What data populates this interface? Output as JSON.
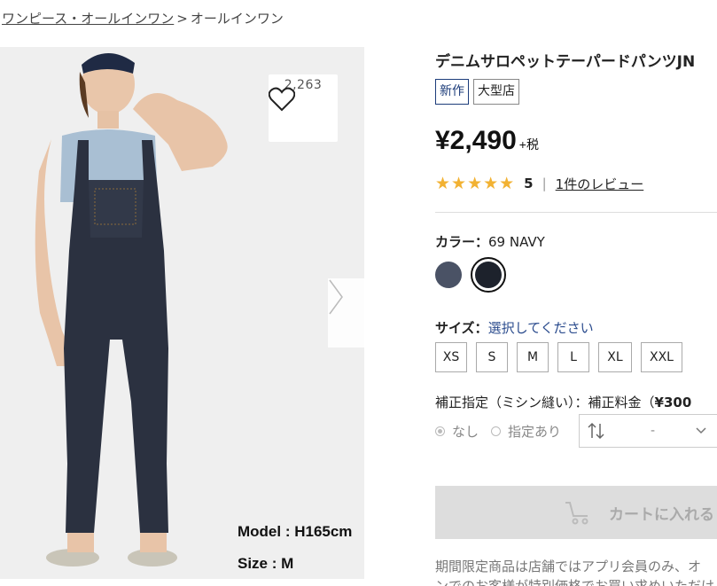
{
  "breadcrumb": {
    "parent": "ワンピース・オールインワン",
    "separator": ">",
    "current": "オールインワン"
  },
  "gallery": {
    "favorite_count": "2,263",
    "caption_model": "Model : H165cm",
    "caption_size": "Size : M"
  },
  "product": {
    "title": "デニムサロペットテーパードパンツJN",
    "badges": [
      "新作",
      "大型店"
    ],
    "price": "¥2,490",
    "tax_label": "+税",
    "stars": "★★★★★",
    "rating": "5",
    "rating_separator": "|",
    "reviews_link": "1件のレビュー"
  },
  "color": {
    "label": "カラー：",
    "value": "69 NAVY",
    "swatches": [
      "#4a5265",
      "#1d222c"
    ]
  },
  "size": {
    "label": "サイズ：",
    "prompt": "選択してください",
    "options": [
      "XS",
      "S",
      "M",
      "L",
      "XL",
      "XXL"
    ]
  },
  "alteration": {
    "label": "補正指定（ミシン縫い）：補正料金（",
    "fee": "¥300",
    "option_none": "なし",
    "option_some": "指定あり",
    "select_value": "-"
  },
  "cart": {
    "label": "カートに入れる"
  },
  "notice": {
    "line1": "期間限定商品は店舗ではアプリ会員のみ、オ",
    "line2": "ンでのお客様が特別価格でお買い求めいただけ"
  },
  "colors": {
    "accent_navy": "#1c3c7a",
    "star": "#f2b233",
    "link": "#2a4b8d",
    "cart_disabled_bg": "#dddddd"
  }
}
